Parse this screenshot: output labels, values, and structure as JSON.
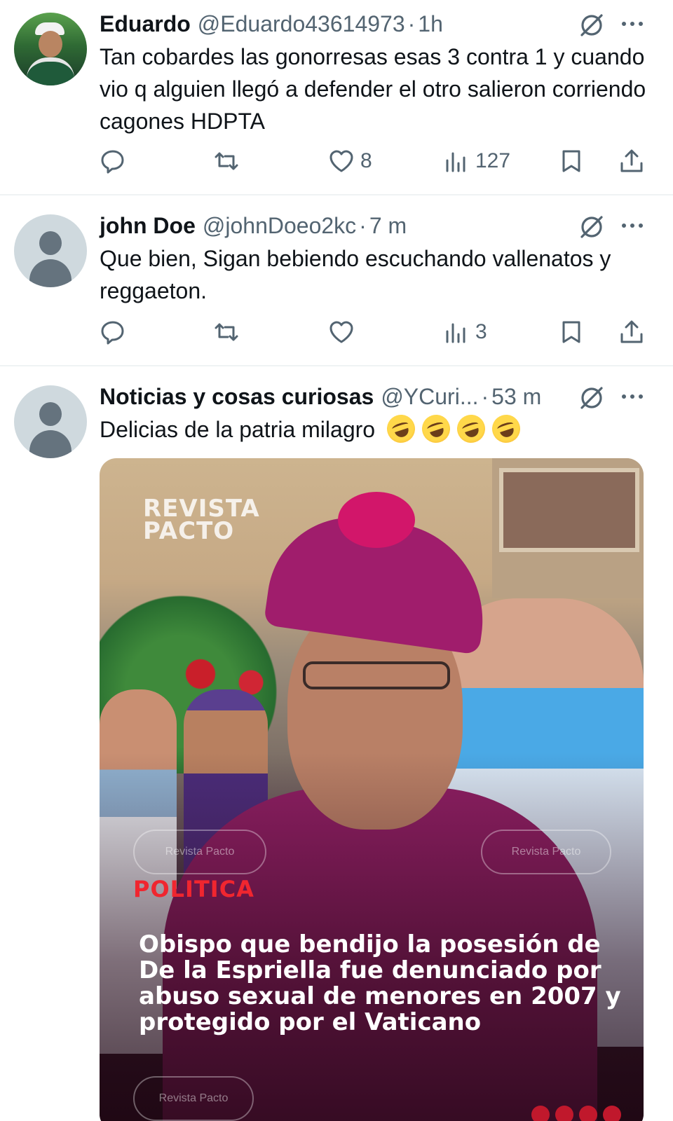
{
  "tweets": [
    {
      "name": "Eduardo",
      "handle": "@Eduardo43614973",
      "sep": "·",
      "time": "1h",
      "text": "Tan cobardes las gonorresas esas 3 contra 1 y cuando vio q alguien llegó a defender el otro salieron corriendo cagones HDPTA",
      "likes": "8",
      "views": "127"
    },
    {
      "name": "john Doe",
      "handle": "@johnDoeo2kc",
      "sep": "·",
      "time": "7 m",
      "text": "Que bien, Sigan bebiendo escuchando vallenatos y reggaeton.",
      "likes": "",
      "views": "3"
    },
    {
      "name": "Noticias y cosas curiosas",
      "handle": "@YCuri...",
      "sep": "·",
      "time": "53 m",
      "text": "Delicias de la patria milagro",
      "emoji_count": 4,
      "media": {
        "brand": "REVISTA PACTO",
        "brand_line1": "REVISTA",
        "brand_line2": "PACTO",
        "pill_left": "Revista Pacto",
        "pill_right": "Revista Pacto",
        "pill_bottom": "Revista Pacto",
        "category": "POLITICA",
        "headline": "Obispo que bendijo la posesión de De la Espriella fue denunciado por abuso sexual de menores en 2007 y protegido por el Vaticano"
      }
    }
  ],
  "icons": {
    "reply": "reply-icon",
    "retweet": "retweet-icon",
    "like": "heart-icon",
    "views": "views-icon",
    "bookmark": "bookmark-icon",
    "share": "share-icon",
    "grok": "grok-icon",
    "more": "more-icon"
  },
  "colors": {
    "text": "#0f1419",
    "secondary": "#536471",
    "divider": "#eff3f4",
    "headline_red": "#f0262f"
  }
}
